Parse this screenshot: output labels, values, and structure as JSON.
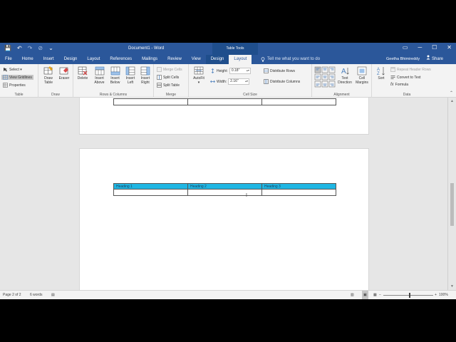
{
  "qat": {
    "save": "💾",
    "undo": "↶",
    "redo": "↷",
    "extra": "⊘",
    "more": "⌄"
  },
  "title": "Document1 - Word",
  "contextual_label": "Table Tools",
  "window_controls": {
    "restore": "▭",
    "minimize": "─",
    "maximize": "☐",
    "close": "✕"
  },
  "tabs": [
    "File",
    "Home",
    "Insert",
    "Design",
    "Layout",
    "References",
    "Mailings",
    "Review",
    "View"
  ],
  "context_tabs": [
    "Design",
    "Layout"
  ],
  "tell_me": "Tell me what you want to do",
  "user": "Geetha Bhimireddy",
  "share": "Share",
  "ribbon": {
    "table": {
      "select": "Select ▾",
      "view_gridlines": "View Gridlines",
      "properties": "Properties",
      "label": "Table"
    },
    "draw": {
      "draw_table": "Draw\nTable",
      "eraser": "Eraser",
      "label": "Draw"
    },
    "rows_cols": {
      "delete": "Delete",
      "insert_above": "Insert\nAbove",
      "insert_below": "Insert\nBelow",
      "insert_left": "Insert\nLeft",
      "insert_right": "Insert\nRight",
      "label": "Rows & Columns"
    },
    "merge": {
      "merge_cells": "Merge Cells",
      "split_cells": "Split Cells",
      "split_table": "Split Table",
      "label": "Merge"
    },
    "cell_size": {
      "autofit": "AutoFit",
      "height_label": "Height:",
      "height_value": "0.18\"",
      "width_label": "Width:",
      "width_value": "2.16\"",
      "distribute_rows": "Distribute Rows",
      "distribute_columns": "Distribute Columns",
      "label": "Cell Size"
    },
    "alignment": {
      "text_direction": "Text\nDirection",
      "cell_margins": "Cell\nMargins",
      "label": "Alignment"
    },
    "data": {
      "sort": "Sort",
      "repeat_header": "Repeat Header Rows",
      "convert_text": "Convert to Text",
      "formula": "Formula",
      "label": "Data"
    }
  },
  "table": {
    "headings": [
      "Heading 1",
      "Heading 2",
      "Heading 3"
    ]
  },
  "status": {
    "page": "Page 2 of 2",
    "words": "6 words",
    "zoom": "100%",
    "zoom_level": 1.0
  },
  "colors": {
    "word_blue": "#2b579a",
    "header_fill": "#1fb6e3"
  }
}
